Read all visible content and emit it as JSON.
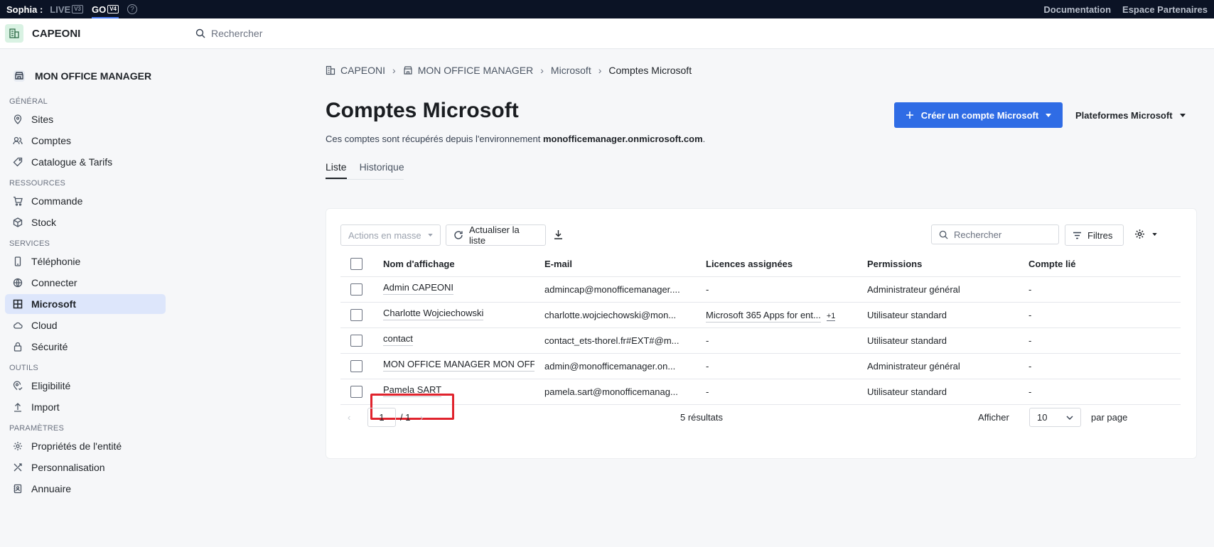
{
  "topbar": {
    "brand": "Sophia :",
    "env_live": "LIVE",
    "env_live_ver": "V3",
    "env_go": "GO",
    "env_go_ver": "V4",
    "help": "?",
    "doc_link": "Documentation",
    "partners_link": "Espace Partenaires"
  },
  "header": {
    "org_name": "CAPEONI",
    "search_placeholder": "Rechercher"
  },
  "sidebar": {
    "entity": "MON OFFICE MANAGER",
    "sec_general": "GÉNÉRAL",
    "sites": "Sites",
    "comptes": "Comptes",
    "catalogue": "Catalogue & Tarifs",
    "sec_ressources": "RESSOURCES",
    "commande": "Commande",
    "stock": "Stock",
    "sec_services": "SERVICES",
    "telephonie": "Téléphonie",
    "connecter": "Connecter",
    "microsoft": "Microsoft",
    "cloud": "Cloud",
    "securite": "Sécurité",
    "sec_outils": "OUTILS",
    "eligibilite": "Eligibilité",
    "import": "Import",
    "sec_parametres": "PARAMÈTRES",
    "proprietes": "Propriétés de l'entité",
    "personnalisation": "Personnalisation",
    "annuaire": "Annuaire"
  },
  "breadcrumb": {
    "c1": "CAPEONI",
    "c2": "MON OFFICE MANAGER",
    "c3": "Microsoft",
    "c4": "Comptes Microsoft"
  },
  "page": {
    "title": "Comptes Microsoft",
    "desc_prefix": "Ces comptes sont récupérés depuis l'environnement ",
    "desc_domain": "monofficemanager.onmicrosoft.com",
    "desc_suffix": ".",
    "create_button": "Créer un compte Microsoft",
    "platforms_button": "Plateformes Microsoft"
  },
  "tabs": {
    "liste": "Liste",
    "historique": "Historique"
  },
  "toolbar": {
    "mass_actions": "Actions en masse",
    "refresh": "Actualiser la liste",
    "search_placeholder": "Rechercher",
    "filters": "Filtres"
  },
  "table": {
    "headers": {
      "name": "Nom d'affichage",
      "email": "E-mail",
      "licences": "Licences assignées",
      "permissions": "Permissions",
      "linked": "Compte lié"
    },
    "rows": [
      {
        "name": "Admin CAPEONI",
        "email": "admincap@monofficemanager....",
        "licence": "-",
        "licence_extra": "",
        "permission": "Administrateur général",
        "linked": "-"
      },
      {
        "name": "Charlotte Wojciechowski",
        "email": "charlotte.wojciechowski@mon...",
        "licence": "Microsoft 365 Apps for ent...",
        "licence_extra": "+1",
        "permission": "Utilisateur standard",
        "linked": "-"
      },
      {
        "name": "contact",
        "email": "contact_ets-thorel.fr#EXT#@m...",
        "licence": "-",
        "licence_extra": "",
        "permission": "Utilisateur standard",
        "linked": "-"
      },
      {
        "name": "MON OFFICE MANAGER MON OFFIC",
        "email": "admin@monofficemanager.on...",
        "licence": "-",
        "licence_extra": "",
        "permission": "Administrateur général",
        "linked": "-"
      },
      {
        "name": "Pamela SART",
        "email": "pamela.sart@monofficemanag...",
        "licence": "-",
        "licence_extra": "",
        "permission": "Utilisateur standard",
        "linked": "-"
      }
    ]
  },
  "pager": {
    "page": "1",
    "total": "/ 1",
    "results": "5 résultats",
    "show": "Afficher",
    "per_page_value": "10",
    "per_page": "par page"
  },
  "colors": {
    "accent": "#2f6ce5",
    "topbar": "#0b1325",
    "highlight": "#e0232d"
  }
}
